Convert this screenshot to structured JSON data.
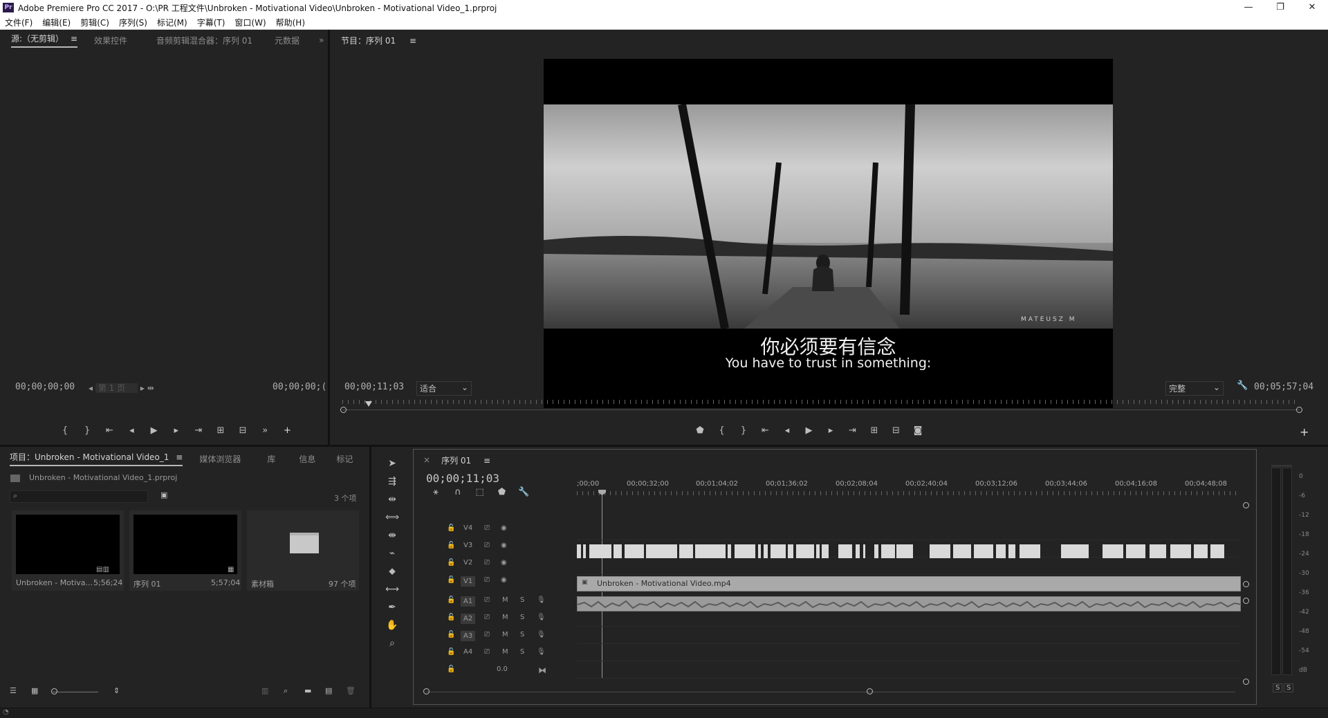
{
  "window": {
    "title": "Adobe Premiere Pro CC 2017 - O:\\PR 工程文件\\Unbroken - Motivational Video\\Unbroken - Motivational Video_1.prproj",
    "app_icon": "Pr",
    "minimize": "—",
    "restore": "❐",
    "close": "✕"
  },
  "menu": [
    "文件(F)",
    "编辑(E)",
    "剪辑(C)",
    "序列(S)",
    "标记(M)",
    "字幕(T)",
    "窗口(W)",
    "帮助(H)"
  ],
  "source_panel": {
    "tabs": [
      "源:（无剪辑）",
      "效果控件",
      "音频剪辑混合器：序列 01",
      "元数据"
    ],
    "timecode_left": "00;00;00;00",
    "page_label": "第 1 页",
    "timecode_right": "00;00;00;("
  },
  "program_panel": {
    "tab": "节目：序列 01",
    "timecode_left": "00;00;11;03",
    "zoom": "适合",
    "quality": "完整",
    "timecode_right": "00;05;57;04",
    "subtitle_cn": "你必须要有信念",
    "subtitle_en": "You have to trust in something:",
    "watermark": "MATEUSZ M"
  },
  "project_panel": {
    "tabs": [
      "项目：Unbroken - Motivational Video_1",
      "媒体浏览器",
      "库",
      "信息",
      "标记"
    ],
    "project_file": "Unbroken - Motivational Video_1.prproj",
    "item_count": "3 个项",
    "items": [
      {
        "name": "Unbroken - Motiva...",
        "duration": "5;56;24"
      },
      {
        "name": "序列 01",
        "duration": "5;57;04"
      },
      {
        "name": "素材箱",
        "duration": "97 个项"
      }
    ]
  },
  "timeline": {
    "tab": "序列 01",
    "timecode": "00;00;11;03",
    "ruler": [
      ";00;00",
      "00;00;32;00",
      "00;01;04;02",
      "00;01;36;02",
      "00;02;08;04",
      "00;02;40;04",
      "00;03;12;06",
      "00;03;44;06",
      "00;04;16;08",
      "00;04;48;08"
    ],
    "video_tracks": [
      "V4",
      "V3",
      "V2",
      "V1"
    ],
    "audio_tracks": [
      "A1",
      "A2",
      "A3",
      "A4"
    ],
    "clip_v1": "Unbroken - Motivational Video.mp4",
    "master_vol": "0.0",
    "m_label": "M",
    "s_label": "S"
  },
  "meters": {
    "scale": [
      "0",
      "-6",
      "-12",
      "-18",
      "-24",
      "-30",
      "-36",
      "-42",
      "-48",
      "-54",
      "dB"
    ],
    "solo": [
      "S",
      "S"
    ]
  },
  "colors": {
    "panel_bg": "#232323",
    "clip_gray": "#a9a9a9",
    "track_active": "#3a3a3a"
  }
}
